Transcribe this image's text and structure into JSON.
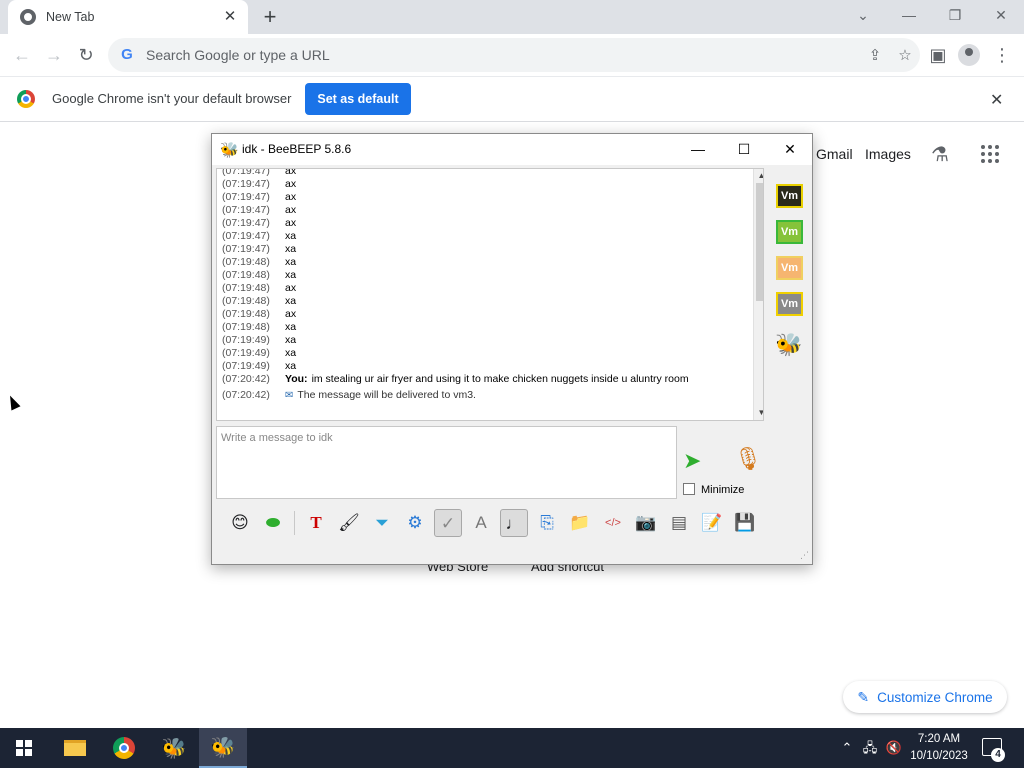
{
  "browser": {
    "tab_title": "New Tab",
    "tab_close": "✕",
    "new_tab": "+",
    "omnibox_placeholder": "Search Google or type a URL",
    "g_letter": "G"
  },
  "infobar": {
    "message": "Google Chrome isn't your default browser",
    "button": "Set as default",
    "close": "✕"
  },
  "ntp": {
    "gmail": "Gmail",
    "images": "Images",
    "shortcut_web_store": "Web Store",
    "shortcut_add": "Add shortcut",
    "customize": "Customize Chrome"
  },
  "beebeep": {
    "title": "idk - BeeBEEP 5.8.6",
    "messages": [
      {
        "time": "(07:19:47)",
        "text": "ax"
      },
      {
        "time": "(07:19:47)",
        "text": "ax"
      },
      {
        "time": "(07:19:47)",
        "text": "ax"
      },
      {
        "time": "(07:19:47)",
        "text": "ax"
      },
      {
        "time": "(07:19:47)",
        "text": "ax"
      },
      {
        "time": "(07:19:47)",
        "text": "xa"
      },
      {
        "time": "(07:19:47)",
        "text": "xa"
      },
      {
        "time": "(07:19:48)",
        "text": "xa"
      },
      {
        "time": "(07:19:48)",
        "text": "xa"
      },
      {
        "time": "(07:19:48)",
        "text": "ax"
      },
      {
        "time": "(07:19:48)",
        "text": "xa"
      },
      {
        "time": "(07:19:48)",
        "text": "ax"
      },
      {
        "time": "(07:19:48)",
        "text": "xa"
      },
      {
        "time": "(07:19:49)",
        "text": "xa"
      },
      {
        "time": "(07:19:49)",
        "text": "xa"
      },
      {
        "time": "(07:19:49)",
        "text": "xa"
      }
    ],
    "you_message": {
      "time": "(07:20:42)",
      "who": "You:",
      "text": "im stealing ur air fryer and using it to make chicken nuggets inside u aluntry room"
    },
    "system_message": {
      "time": "(07:20:42)",
      "text": "The message will be delivered to vm3."
    },
    "users": [
      {
        "label": "Vm",
        "bg": "#2a2a1a",
        "border": "#e8d000",
        "color": "#ffffff"
      },
      {
        "label": "Vm",
        "bg": "#86c33a",
        "border": "#3ab83a",
        "color": "#ffffff"
      },
      {
        "label": "Vm",
        "bg": "#f6b570",
        "border": "#f0d060",
        "color": "#ffffff"
      },
      {
        "label": "Vm",
        "bg": "#8a8a8a",
        "border": "#f0d000",
        "color": "#ffffff"
      }
    ],
    "input_placeholder": "Write a message to idk",
    "minimize_label": "Minimize"
  },
  "taskbar": {
    "time": "7:20 AM",
    "date": "10/10/2023",
    "notifications": "4"
  }
}
